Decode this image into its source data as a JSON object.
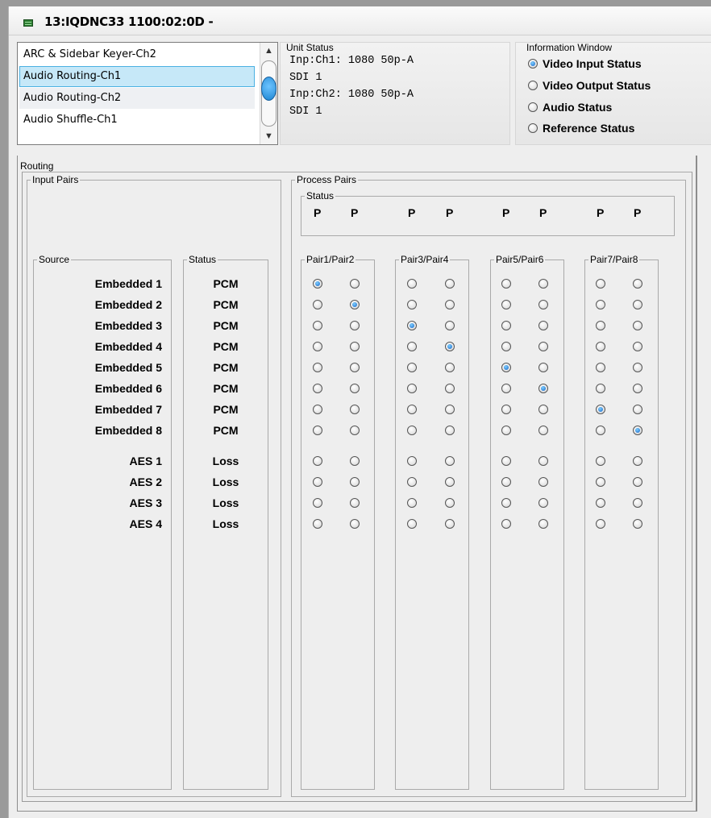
{
  "window": {
    "title": "13:IQDNC33  1100:02:0D  -"
  },
  "module_list": {
    "items": [
      {
        "label": "ARC & Sidebar Keyer-Ch2",
        "selected": false
      },
      {
        "label": "Audio Routing-Ch1",
        "selected": true
      },
      {
        "label": "Audio Routing-Ch2",
        "selected": false
      },
      {
        "label": "Audio Shuffle-Ch1",
        "selected": false
      }
    ],
    "scroll_up_icon": "chevron-up-icon",
    "scroll_down_icon": "chevron-down-icon"
  },
  "unit_status": {
    "title": "Unit Status",
    "lines": [
      "Inp:Ch1: 1080 50p-A",
      "SDI 1",
      "Inp:Ch2: 1080 50p-A",
      "SDI 1"
    ]
  },
  "info_window": {
    "title": "Information Window",
    "options": [
      {
        "label": "Video Input Status",
        "selected": true
      },
      {
        "label": "Video Output Status",
        "selected": false
      },
      {
        "label": "Audio Status",
        "selected": false
      },
      {
        "label": "Reference Status",
        "selected": false
      }
    ]
  },
  "routing": {
    "title": "Routing",
    "input_pairs": {
      "title": "Input Pairs",
      "source_header": "Source",
      "status_header": "Status",
      "rows": [
        {
          "source": "Embedded 1",
          "status": "PCM"
        },
        {
          "source": "Embedded 2",
          "status": "PCM"
        },
        {
          "source": "Embedded 3",
          "status": "PCM"
        },
        {
          "source": "Embedded 4",
          "status": "PCM"
        },
        {
          "source": "Embedded 5",
          "status": "PCM"
        },
        {
          "source": "Embedded 6",
          "status": "PCM"
        },
        {
          "source": "Embedded 7",
          "status": "PCM"
        },
        {
          "source": "Embedded 8",
          "status": "PCM"
        },
        {
          "source": "AES 1",
          "status": "Loss"
        },
        {
          "source": "AES 2",
          "status": "Loss"
        },
        {
          "source": "AES 3",
          "status": "Loss"
        },
        {
          "source": "AES 4",
          "status": "Loss"
        }
      ]
    },
    "process_pairs": {
      "title": "Process Pairs",
      "status_title": "Status",
      "status_values": [
        "P",
        "P",
        "P",
        "P",
        "P",
        "P",
        "P",
        "P"
      ],
      "groups": [
        "Pair1/Pair2",
        "Pair3/Pair4",
        "Pair5/Pair6",
        "Pair7/Pair8"
      ],
      "selected_source_row_per_channel": [
        1,
        2,
        3,
        4,
        5,
        6,
        7,
        8
      ]
    }
  }
}
